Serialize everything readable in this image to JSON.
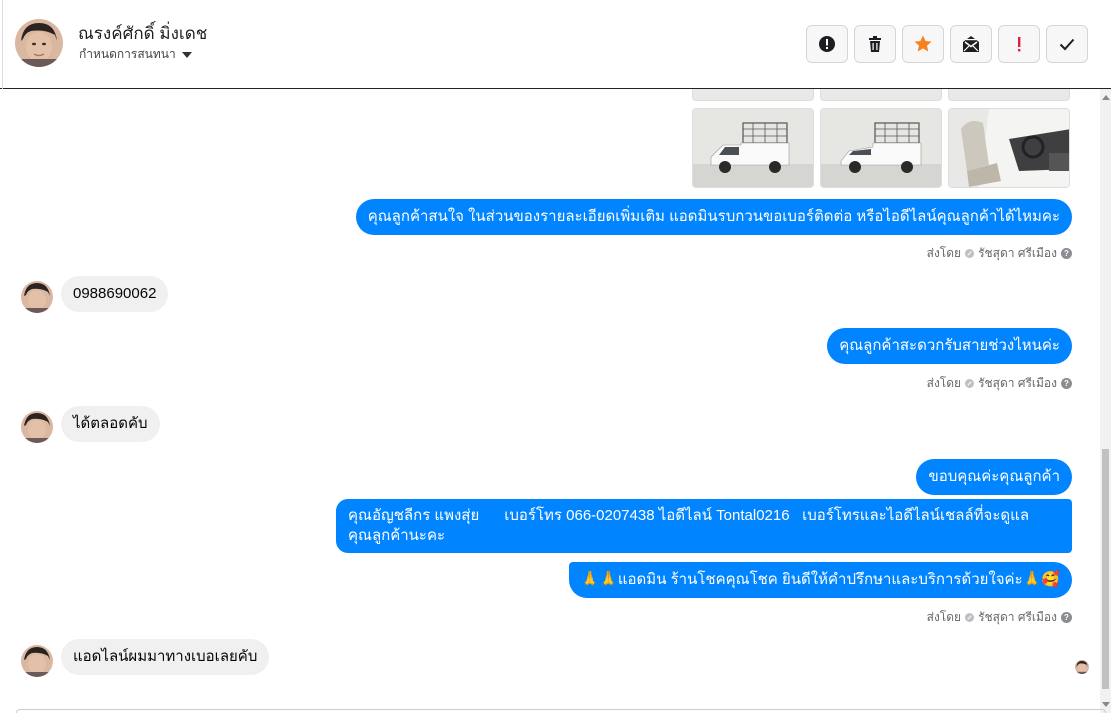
{
  "header": {
    "contact_name": "ณรงค์ศักดิ์ มิ่งเดช",
    "assign_label": "กำหนดการสนทนา",
    "actions": [
      {
        "name": "mark-spam-button",
        "icon": "alert-circle-icon"
      },
      {
        "name": "delete-button",
        "icon": "trash-icon"
      },
      {
        "name": "star-button",
        "icon": "star-icon"
      },
      {
        "name": "mark-unread-button",
        "icon": "envelope-icon"
      },
      {
        "name": "follow-up-button",
        "icon": "exclamation-icon"
      },
      {
        "name": "done-button",
        "icon": "check-icon"
      }
    ]
  },
  "messages": {
    "m1": "คุณลูกค้าสนใจ ในส่วนของรายละเอียดเพิ่มเติม แอดมินรบกวนขอเบอร์ติดต่อ หรือไอดีไลน์คุณลูกค้าได้ไหมคะ",
    "m2": "0988690062",
    "m3": "คุณลูกค้าสะดวกรับสายช่วงไหนค่ะ",
    "m4": "ได้ตลอดคับ",
    "m5": "ขอบคุณค่ะคุณลูกค้า",
    "m6_line1": "คุณอัญชลีกร แพงสุ่ย      เบอร์โทร 066-0207438 ไอดีไลน์ Tontal0216   เบอร์โทรและไอดีไลน์เชลล์ที่จะดูแล",
    "m6_line2": "คุณลูกค้านะคะ",
    "m7": "🙏🙏แอดมิน ร้านโชคคุณโชค ยินดีให้คำปรึกษาและบริการด้วยใจค่ะ🙏🥰",
    "m8": "แอดไลน์ผมมาทางเบอเลยคับ"
  },
  "sent_by": {
    "label": "ส่งโดย",
    "agent": "รัชสุดา ศรีเมือง"
  },
  "colors": {
    "outgoing_bubble": "#0084ff",
    "incoming_bubble": "#f0f0f0",
    "star": "#f5821f",
    "follow_up": "#e41e3f"
  }
}
